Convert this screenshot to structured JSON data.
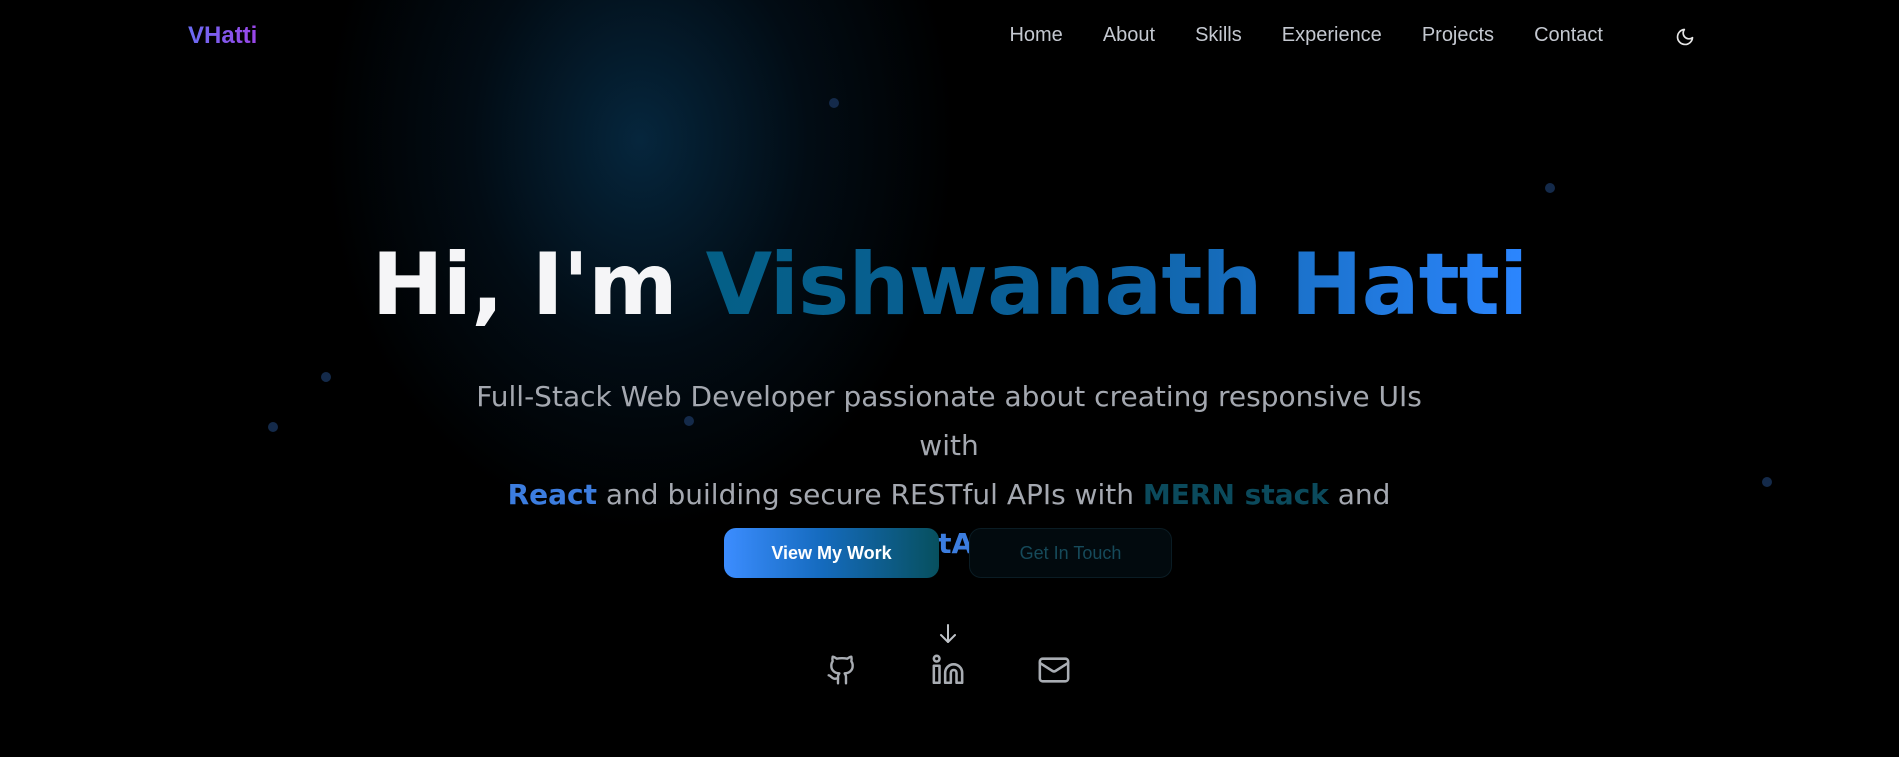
{
  "header": {
    "logo": "VHatti",
    "nav": {
      "home": "Home",
      "about": "About",
      "skills": "Skills",
      "experience": "Experience",
      "projects": "Projects",
      "contact": "Contact"
    },
    "theme_toggle_icon": "moon-icon"
  },
  "hero": {
    "greeting": "Hi, I'm",
    "name": "Vishwanath Hatti",
    "tagline": {
      "part1": "Full-Stack Web Developer passionate about creating responsive UIs with",
      "react": "React",
      "part2": "and building secure RESTful APIs with",
      "mern": "MERN stack",
      "part3": "and",
      "fastapi": "FastAPI",
      "end": "."
    },
    "buttons": {
      "primary": "View My Work",
      "secondary": "Get In Touch"
    },
    "scroll_icon": "arrow-down-icon"
  },
  "social": {
    "github_icon": "github-icon",
    "linkedin_icon": "linkedin-icon",
    "email_icon": "mail-icon"
  },
  "colors": {
    "background": "#000000",
    "logo_gradient_start": "#6a6cf2",
    "logo_gradient_end": "#9a45e8",
    "accent_blue": "#3c7ddf",
    "accent_teal": "#0b4a5c",
    "name_gradient_end": "#2c86ff",
    "nav_text": "#c4c8d0"
  }
}
